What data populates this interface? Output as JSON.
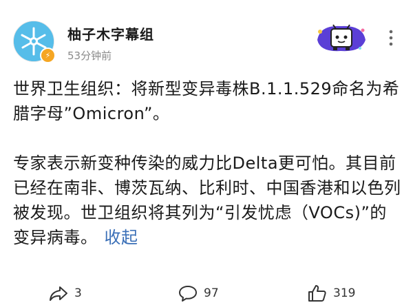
{
  "post": {
    "username": "柚子木字幕组",
    "timestamp": "53分钟前",
    "paragraph1": "世界卫生组织：将新型变异毒株B.1.1.529命名为希腊字母”Omicron”。",
    "paragraph2": "专家表示新变种传染的威力比Delta更可怕。其目前已经在南非、博茨瓦纳、比利时、中国香港和以色列被发现。世卫组织将其列为“引发忧虑（VOCs)”的变异病毒。",
    "collapse_label": "收起"
  },
  "actions": {
    "repost_count": "3",
    "comment_count": "97",
    "like_count": "319"
  },
  "icons": {
    "avatar": "fan-logo-avatar",
    "verified": "lightning-badge-icon",
    "fan_badge": "tv-mascot-badge",
    "more": "more-vertical-icon",
    "repost": "share-arrow-icon",
    "comment": "comment-bubble-icon",
    "like": "thumbs-up-icon"
  },
  "colors": {
    "link": "#3a6fb7",
    "meta": "#8a8a8a",
    "verified": "#f5a623"
  }
}
